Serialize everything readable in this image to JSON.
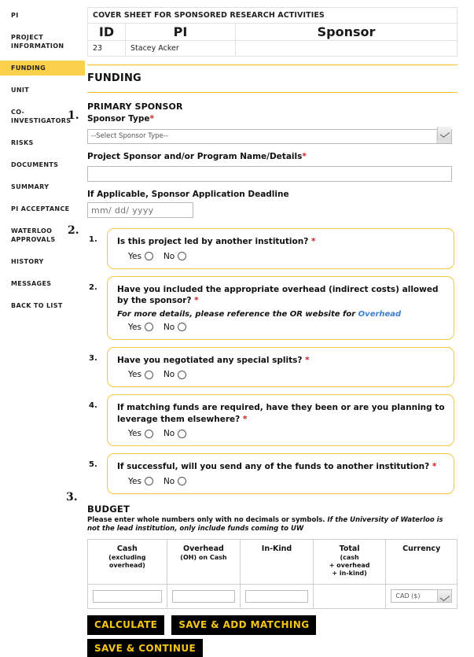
{
  "sidebar": {
    "items": [
      {
        "label": "PI",
        "active": false
      },
      {
        "label": "PROJECT INFORMATION",
        "active": false
      },
      {
        "label": "FUNDING",
        "active": true
      },
      {
        "label": "UNIT",
        "active": false
      },
      {
        "label": "CO-INVESTIGATORS",
        "active": false
      },
      {
        "label": "RISKS",
        "active": false
      },
      {
        "label": "DOCUMENTS",
        "active": false
      },
      {
        "label": "SUMMARY",
        "active": false
      },
      {
        "label": "PI ACCEPTANCE",
        "active": false
      },
      {
        "label": "WATERLOO APPROVALS",
        "active": false
      },
      {
        "label": "HISTORY",
        "active": false
      },
      {
        "label": "MESSAGES",
        "active": false
      },
      {
        "label": "BACK TO LIST",
        "active": false
      }
    ]
  },
  "cover_sheet": {
    "title": "COVER SHEET FOR SPONSORED RESEARCH ACTIVITIES",
    "columns": [
      "ID",
      "PI",
      "Sponsor"
    ],
    "row": {
      "id": "23",
      "pi": "Stacey Acker",
      "sponsor": ""
    }
  },
  "section": {
    "title": "FUNDING"
  },
  "markers": {
    "one": "1.",
    "two": "2.",
    "three": "3."
  },
  "primary_sponsor": {
    "heading": "PRIMARY SPONSOR",
    "sponsor_type_label": "Sponsor Type",
    "sponsor_type_required": "*",
    "sponsor_type_value": "--Select Sponsor Type--",
    "sponsor_type_options": [
      "--Select Sponsor Type--"
    ],
    "program_label": "Project Sponsor and/or Program Name/Details",
    "program_required": "*",
    "program_value": "",
    "deadline_label": "If Applicable, Sponsor Application Deadline",
    "deadline_placeholder": "mm/ dd/ yyyy",
    "deadline_value": ""
  },
  "questions": [
    {
      "num": "1.",
      "text": "Is this project led by another institution? ",
      "required": "*",
      "note": null,
      "note_link": null,
      "yes_label": "Yes",
      "no_label": "No"
    },
    {
      "num": "2.",
      "text": "Have you included the appropriate overhead (indirect costs) allowed by the sponsor? ",
      "required": "*",
      "note": "For more details, please reference the OR website for ",
      "note_link": "Overhead",
      "yes_label": "Yes",
      "no_label": "No"
    },
    {
      "num": "3.",
      "text": "Have you negotiated any special splits? ",
      "required": "*",
      "note": null,
      "note_link": null,
      "yes_label": "Yes",
      "no_label": "No"
    },
    {
      "num": "4.",
      "text": "If matching funds are required, have they been or are you planning to leverage them elsewhere? ",
      "required": "*",
      "note": null,
      "note_link": null,
      "yes_label": "Yes",
      "no_label": "No"
    },
    {
      "num": "5.",
      "text": "If successful, will you send any of the funds to another institution? ",
      "required": "*",
      "note": null,
      "note_link": null,
      "yes_label": "Yes",
      "no_label": "No"
    }
  ],
  "budget": {
    "heading": "BUDGET",
    "note_plain": "Please enter whole numbers only with no decimals or symbols. ",
    "note_italic": "If the University of Waterloo is not the lead institution, only include funds coming to UW",
    "columns": [
      {
        "main": "Cash",
        "sub": "(excluding\noverhead)"
      },
      {
        "main": "Overhead",
        "sub": "(OH) on Cash"
      },
      {
        "main": "In-Kind",
        "sub": ""
      },
      {
        "main": "Total",
        "sub": "(cash\n+ overhead\n+ in-kind)"
      },
      {
        "main": "Currency",
        "sub": ""
      }
    ],
    "cash_value": "",
    "overhead_value": "",
    "inkind_value": "",
    "total_value": "",
    "currency_value": "CAD ($)",
    "currency_options": [
      "CAD ($)"
    ]
  },
  "buttons": {
    "calculate": "CALCULATE",
    "save_add_matching": "SAVE & ADD MATCHING",
    "save_continue": "SAVE & CONTINUE"
  },
  "colors": {
    "accent_gold": "#fbd14b",
    "rule_gold": "#f2c327",
    "qbox_border": "#f5c842",
    "required_red": "#d02020",
    "link_blue": "#3f7fd0",
    "button_bg": "#000000",
    "button_text": "#f5c518"
  }
}
